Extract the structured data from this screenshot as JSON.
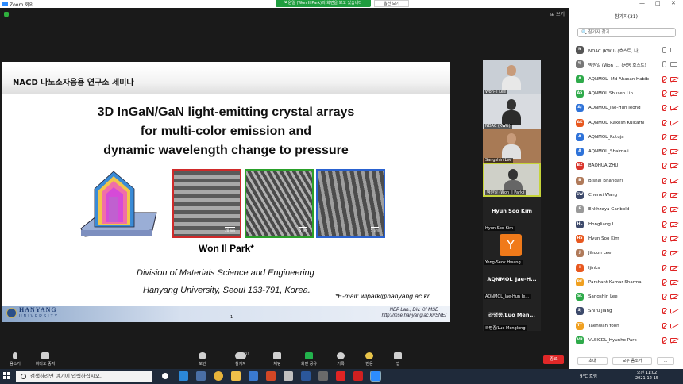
{
  "window": {
    "title": "Zoom 회의",
    "notice": "박원일 (Won Il Park)의 화면을 보고 있습니다",
    "view_options": "옵션 보기",
    "view_label": "보기",
    "controls": [
      "—",
      "□",
      "✕"
    ]
  },
  "slide": {
    "header": "NACD 나노소자응용 연구소 세미나",
    "title_lines": [
      "3D InGaN/GaN light-emitting crystal arrays",
      "for multi-color emission and",
      "dynamic wavelength change to pressure"
    ],
    "scalebar_1": "20 nm",
    "scalebar_2": "5 nm",
    "scalebar_3": "5 nm",
    "author": "Won Il Park*",
    "aff1": "Division of Materials Science and Engineering",
    "aff2": "Hanyang University, Seoul 133-791, Korea.",
    "email": "*E-mail: wipark@hanyang.ac.kr",
    "footer_univ": "HANYANG",
    "footer_univ2": "UNIVERSITY",
    "footer_lab": "NEP Lab., Div. Of MSE",
    "footer_url": "http://mse.hanyang.ac.kr/SNE/",
    "page": "1"
  },
  "video_tiles": [
    {
      "name": "Won-Il Lee",
      "type": "video"
    },
    {
      "name": "NDAC (KWU)",
      "type": "video"
    },
    {
      "name": "Sangshin Lee",
      "type": "video"
    },
    {
      "name": "박원일 (Won Il Park)",
      "type": "video",
      "active": true
    },
    {
      "name": "Hyun Soo Kim",
      "big": "Hyun Soo Kim",
      "type": "name"
    },
    {
      "name": "Yong-Seok Hwang",
      "type": "avatar",
      "letter": "Y"
    },
    {
      "name": "AQNMOL_Jae-Hun Je...",
      "big": "AQNMOL_Jae-H...",
      "type": "name"
    },
    {
      "name": "라명종/Luo Menglong",
      "big": "라명종/Luo Men...",
      "type": "name"
    }
  ],
  "participants_panel": {
    "title": "참가자(31)",
    "search_placeholder": "참가자 찾기",
    "people": [
      {
        "name": "NDAC (KWU) (호스트, 나)",
        "avatar": "N",
        "color": "#555555",
        "mic": "on",
        "cam": "on"
      },
      {
        "name": "박원일 (Won I... (공동 호스트)",
        "avatar": "박",
        "color": "#777777",
        "mic": "on",
        "cam": "on"
      },
      {
        "name": "AQNMOL -Md Ahasan Habib",
        "avatar": "A",
        "color": "#2eaa4a",
        "mic": "off",
        "cam": "off"
      },
      {
        "name": "AQNMOL Shusen Lin",
        "avatar": "AS",
        "color": "#2eaa4a",
        "mic": "off",
        "cam": "off"
      },
      {
        "name": "AQNMOL_Jae-Hun Jeong",
        "avatar": "AJ",
        "color": "#2f73d9",
        "mic": "off",
        "cam": "off"
      },
      {
        "name": "AQNMOL_Rakesh Kulkarni",
        "avatar": "AK",
        "color": "#e8581f",
        "mic": "off",
        "cam": "off"
      },
      {
        "name": "AQNMOL_Rutuja",
        "avatar": "A",
        "color": "#2f73d9",
        "mic": "off",
        "cam": "off"
      },
      {
        "name": "AQNMOL_Shalmali",
        "avatar": "A",
        "color": "#2f73d9",
        "mic": "off",
        "cam": "off"
      },
      {
        "name": "BAOHUA ZHU",
        "avatar": "BZ",
        "color": "#d9342b",
        "mic": "off",
        "cam": "off"
      },
      {
        "name": "Bishal Bhandari",
        "avatar": "B",
        "color": "#b07a5a",
        "mic": "off",
        "cam": "off"
      },
      {
        "name": "Chenxi Wang",
        "avatar": "CW",
        "color": "#3d4a6b",
        "mic": "off",
        "cam": "off"
      },
      {
        "name": "Enkhzaya Ganbold",
        "avatar": "E",
        "color": "#999999",
        "mic": "off",
        "cam": "off"
      },
      {
        "name": "Hongliang Li",
        "avatar": "HL",
        "color": "#3d4a6b",
        "mic": "off",
        "cam": "off"
      },
      {
        "name": "Hyun Soo Kim",
        "avatar": "HS",
        "color": "#e8581f",
        "mic": "off",
        "cam": "off"
      },
      {
        "name": "Jihoon Lee",
        "avatar": "J",
        "color": "#b07a5a",
        "mic": "off",
        "cam": "off"
      },
      {
        "name": "Ijinks",
        "avatar": "I",
        "color": "#e8581f",
        "mic": "off",
        "cam": "off"
      },
      {
        "name": "Parshant Kumar Sharma",
        "avatar": "PK",
        "color": "#f0a020",
        "mic": "off",
        "cam": "off"
      },
      {
        "name": "Sangshin Lee",
        "avatar": "SL",
        "color": "#2eaa4a",
        "mic": "off",
        "cam": "off"
      },
      {
        "name": "Shiru Jiang",
        "avatar": "SJ",
        "color": "#3d4a6b",
        "mic": "off",
        "cam": "off"
      },
      {
        "name": "Taehwan Yoon",
        "avatar": "TY",
        "color": "#f0a020",
        "mic": "off",
        "cam": "off"
      },
      {
        "name": "VLSICDL_Hyunho Park",
        "avatar": "VP",
        "color": "#2eaa4a",
        "mic": "off",
        "cam": "off"
      }
    ],
    "invite": "초대",
    "mute_all": "모두 음소거",
    "more": "..."
  },
  "toolbar": {
    "audio": "음소거",
    "video": "비디오 중지",
    "security": "보안",
    "participants": "참가자",
    "participants_count": "31",
    "chat": "채팅",
    "share": "화면 공유",
    "record": "기록",
    "reactions": "반응",
    "apps": "앱",
    "leave": "종료"
  },
  "taskbar": {
    "search_placeholder": "검색하려면 여기에 입력하십시오.",
    "weather": "9°C 흐림",
    "time": "오전 11:02",
    "date": "2021-12-15"
  }
}
